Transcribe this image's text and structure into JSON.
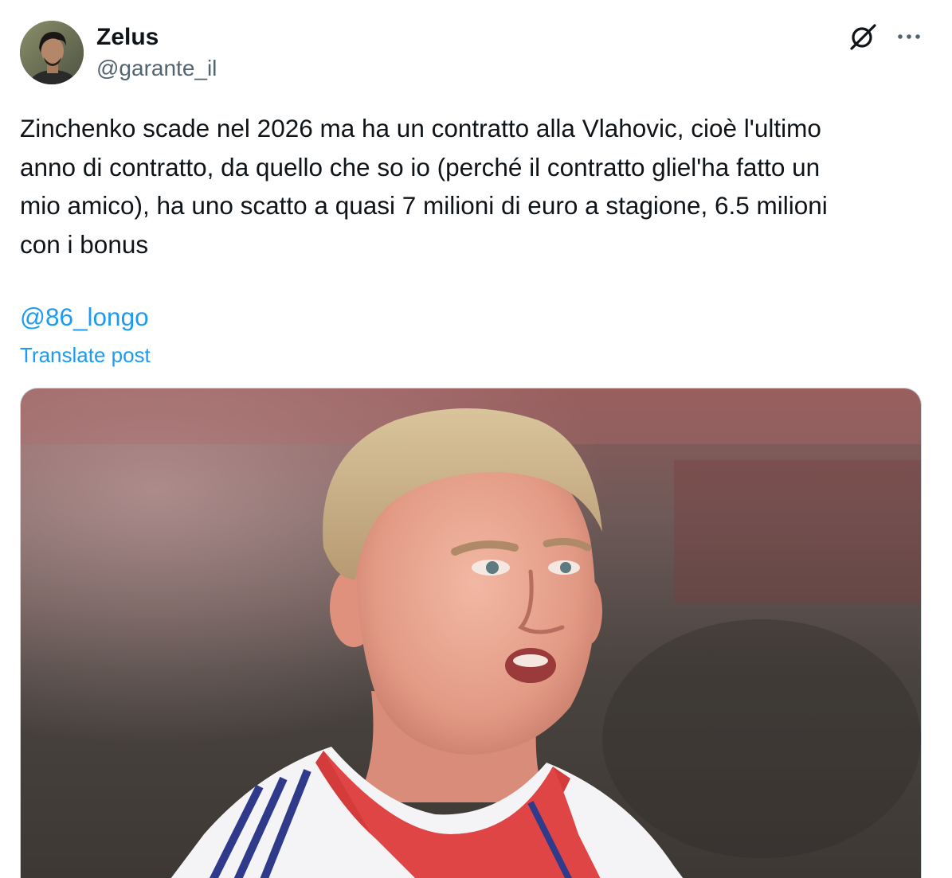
{
  "author": {
    "display_name": "Zelus",
    "handle": "@garante_il"
  },
  "post": {
    "text": "Zinchenko scade nel 2026 ma ha un contratto alla Vlahovic, cioè l'ultimo\nanno di contratto, da quello che so io (perché il contratto gliel'ha fatto un\nmio amico), ha uno scatto a quasi 7 milioni di euro a stagione, 6.5 milioni\ncon i bonus",
    "mention": "@86_longo",
    "translate_label": "Translate post"
  },
  "icons": {
    "grok": "grok-icon",
    "more": "more-options-icon"
  },
  "colors": {
    "text": "#0f1419",
    "secondary": "#536471",
    "link": "#1d9bf0",
    "border": "#cfd9de"
  }
}
